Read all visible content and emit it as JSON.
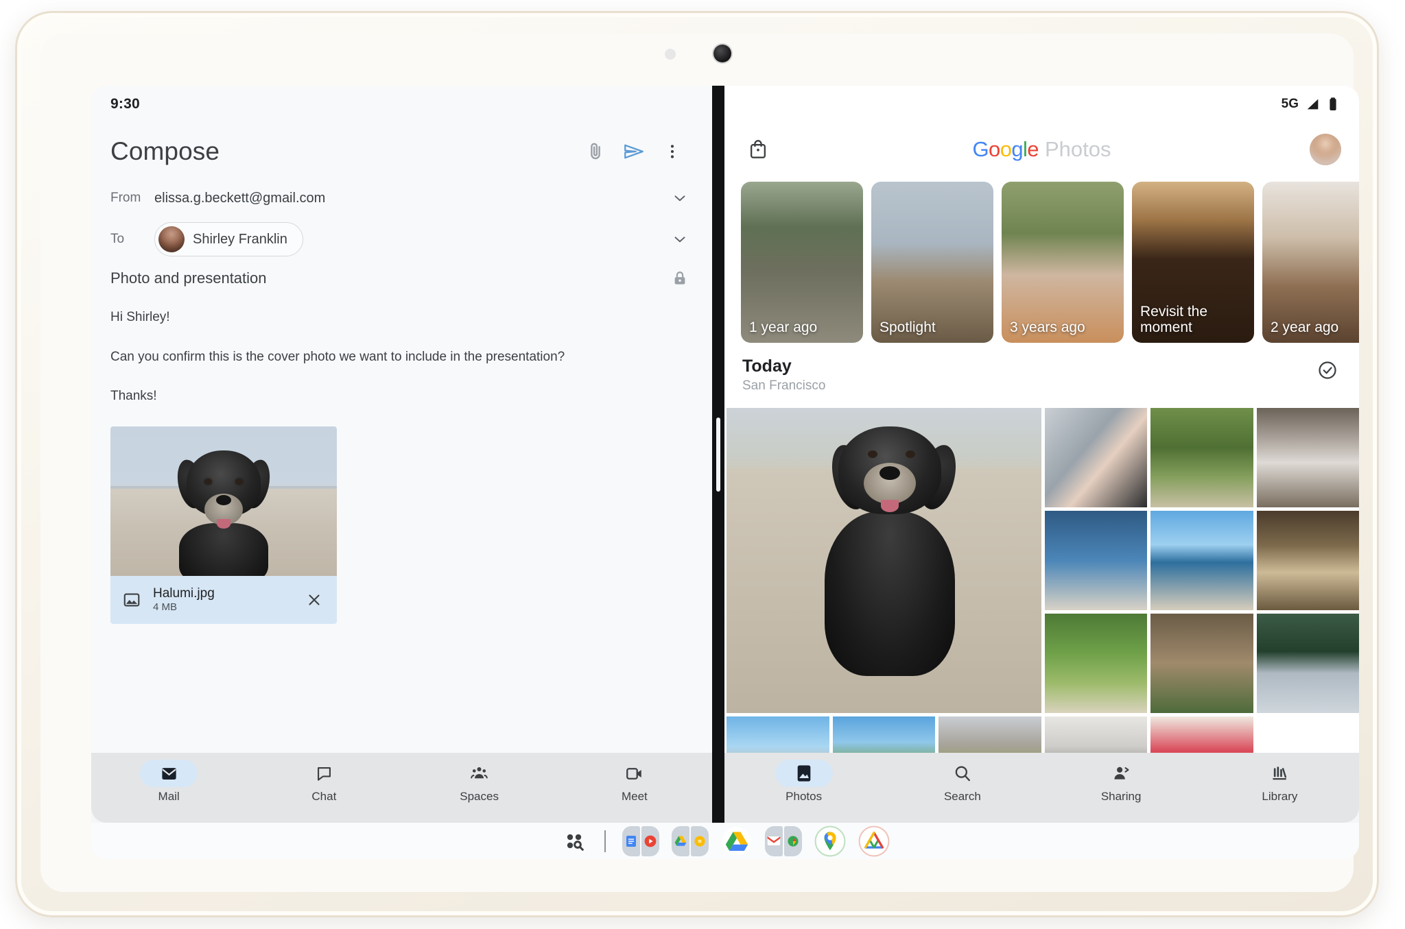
{
  "device": {
    "camera_icon": "camera-lens",
    "sensor_icon": "proximity-sensor"
  },
  "gmail": {
    "status_time": "9:30",
    "compose_title": "Compose",
    "header_actions": [
      {
        "name": "attach-button",
        "icon": "paperclip-icon"
      },
      {
        "name": "send-button",
        "icon": "send-icon"
      },
      {
        "name": "more-options-button",
        "icon": "more-vert-icon"
      }
    ],
    "from": {
      "label": "From",
      "value": "elissa.g.beckett@gmail.com",
      "expand_icon": "chevron-down-icon"
    },
    "to": {
      "label": "To",
      "recipient": "Shirley Franklin",
      "expand_icon": "chevron-down-icon"
    },
    "subject": {
      "value": "Photo and presentation",
      "lock_icon": "lock-icon"
    },
    "body": [
      "Hi Shirley!",
      "Can you confirm this is the cover photo we want to include in the presentation?",
      "Thanks!"
    ],
    "attachment": {
      "name": "Halumi.jpg",
      "size": "4 MB",
      "type_icon": "image-icon",
      "remove_icon": "close-icon"
    },
    "nav": [
      {
        "label": "Mail",
        "icon": "mail-icon",
        "active": true
      },
      {
        "label": "Chat",
        "icon": "chat-icon",
        "active": false
      },
      {
        "label": "Spaces",
        "icon": "spaces-icon",
        "active": false
      },
      {
        "label": "Meet",
        "icon": "meet-icon",
        "active": false
      }
    ]
  },
  "photos": {
    "status": {
      "network": "5G",
      "signal_icon": "signal-icon",
      "battery_icon": "battery-icon"
    },
    "header": {
      "store_icon": "store-bag-icon",
      "logo_google": "Google",
      "logo_product": "Photos",
      "avatar": "profile-avatar"
    },
    "memories": [
      {
        "label": "1 year ago",
        "class": "m0"
      },
      {
        "label": "Spotlight",
        "class": "m1"
      },
      {
        "label": "3 years ago",
        "class": "m2"
      },
      {
        "label": "Revisit the moment",
        "class": "m3"
      },
      {
        "label": "2 year ago",
        "class": "m4"
      }
    ],
    "today": {
      "title": "Today",
      "location": "San Francisco",
      "select_icon": "check-circle-icon"
    },
    "grid": [
      {
        "name": "photo-dog-beach",
        "class": "g-dog"
      },
      {
        "name": "photo-hand-dog",
        "class": "g-hand"
      },
      {
        "name": "photo-garden-sign",
        "class": "g-garden"
      },
      {
        "name": "photo-white-truck",
        "class": "g-truck1"
      },
      {
        "name": "photo-edge-1",
        "class": "g-edge1"
      },
      {
        "name": "photo-beach-shore",
        "class": "g-beach"
      },
      {
        "name": "photo-llama-fence",
        "class": "g-llama"
      },
      {
        "name": "photo-green-field",
        "class": "g-green"
      },
      {
        "name": "photo-edge-2",
        "class": "g-edge2"
      },
      {
        "name": "photo-lake-cliff",
        "class": "g-lake"
      },
      {
        "name": "photo-plaza-building",
        "class": "g-plaza"
      },
      {
        "name": "photo-truck-awning",
        "class": "g-camp"
      },
      {
        "name": "photo-market-basket",
        "class": "g-market"
      },
      {
        "name": "photo-interior-room",
        "class": "g-room"
      },
      {
        "name": "photo-art-wall",
        "class": "g-art"
      }
    ],
    "nav": [
      {
        "label": "Photos",
        "icon": "photos-icon",
        "active": true
      },
      {
        "label": "Search",
        "icon": "search-icon",
        "active": false
      },
      {
        "label": "Sharing",
        "icon": "sharing-icon",
        "active": false
      },
      {
        "label": "Library",
        "icon": "library-icon",
        "active": false
      }
    ]
  },
  "taskbar": {
    "items": [
      {
        "name": "all-apps-button",
        "icon": "apps-search-icon"
      },
      {
        "name": "taskbar-divider",
        "icon": "divider"
      },
      {
        "name": "app-pair-docs-youtube",
        "icon": "app-pair-icon"
      },
      {
        "name": "app-pair-drive-keep",
        "icon": "app-pair-icon"
      },
      {
        "name": "app-google-drive",
        "icon": "drive-icon"
      },
      {
        "name": "app-pair-gmail-slides",
        "icon": "app-pair-icon"
      },
      {
        "name": "app-google-maps",
        "icon": "maps-icon"
      },
      {
        "name": "app-google-home",
        "icon": "home-icon"
      }
    ]
  }
}
